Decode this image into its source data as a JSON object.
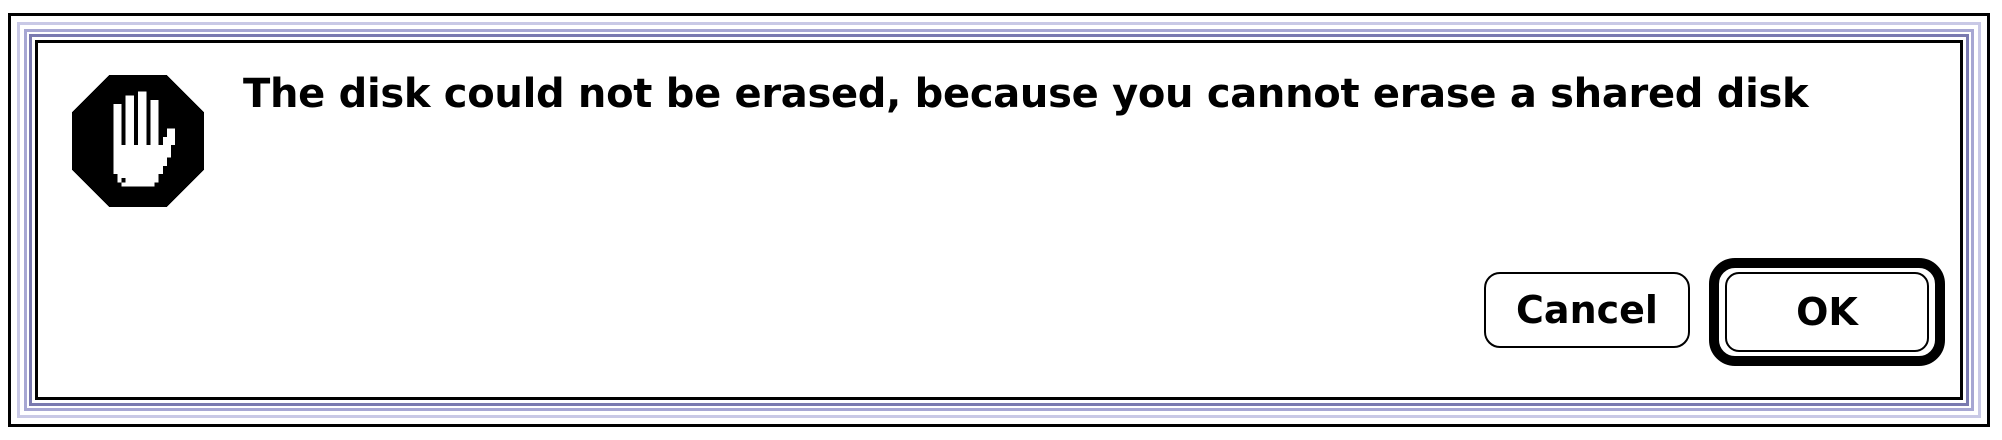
{
  "alert": {
    "icon": "stop-hand-icon",
    "message": "The disk could not be erased, because you cannot erase a shared disk"
  },
  "buttons": {
    "cancel_label": "Cancel",
    "ok_label": "OK"
  },
  "colors": {
    "frame_dark": "#000000",
    "frame_accent": "#7a7ab0",
    "frame_light": "#c9c9e6",
    "background": "#ffffff"
  }
}
